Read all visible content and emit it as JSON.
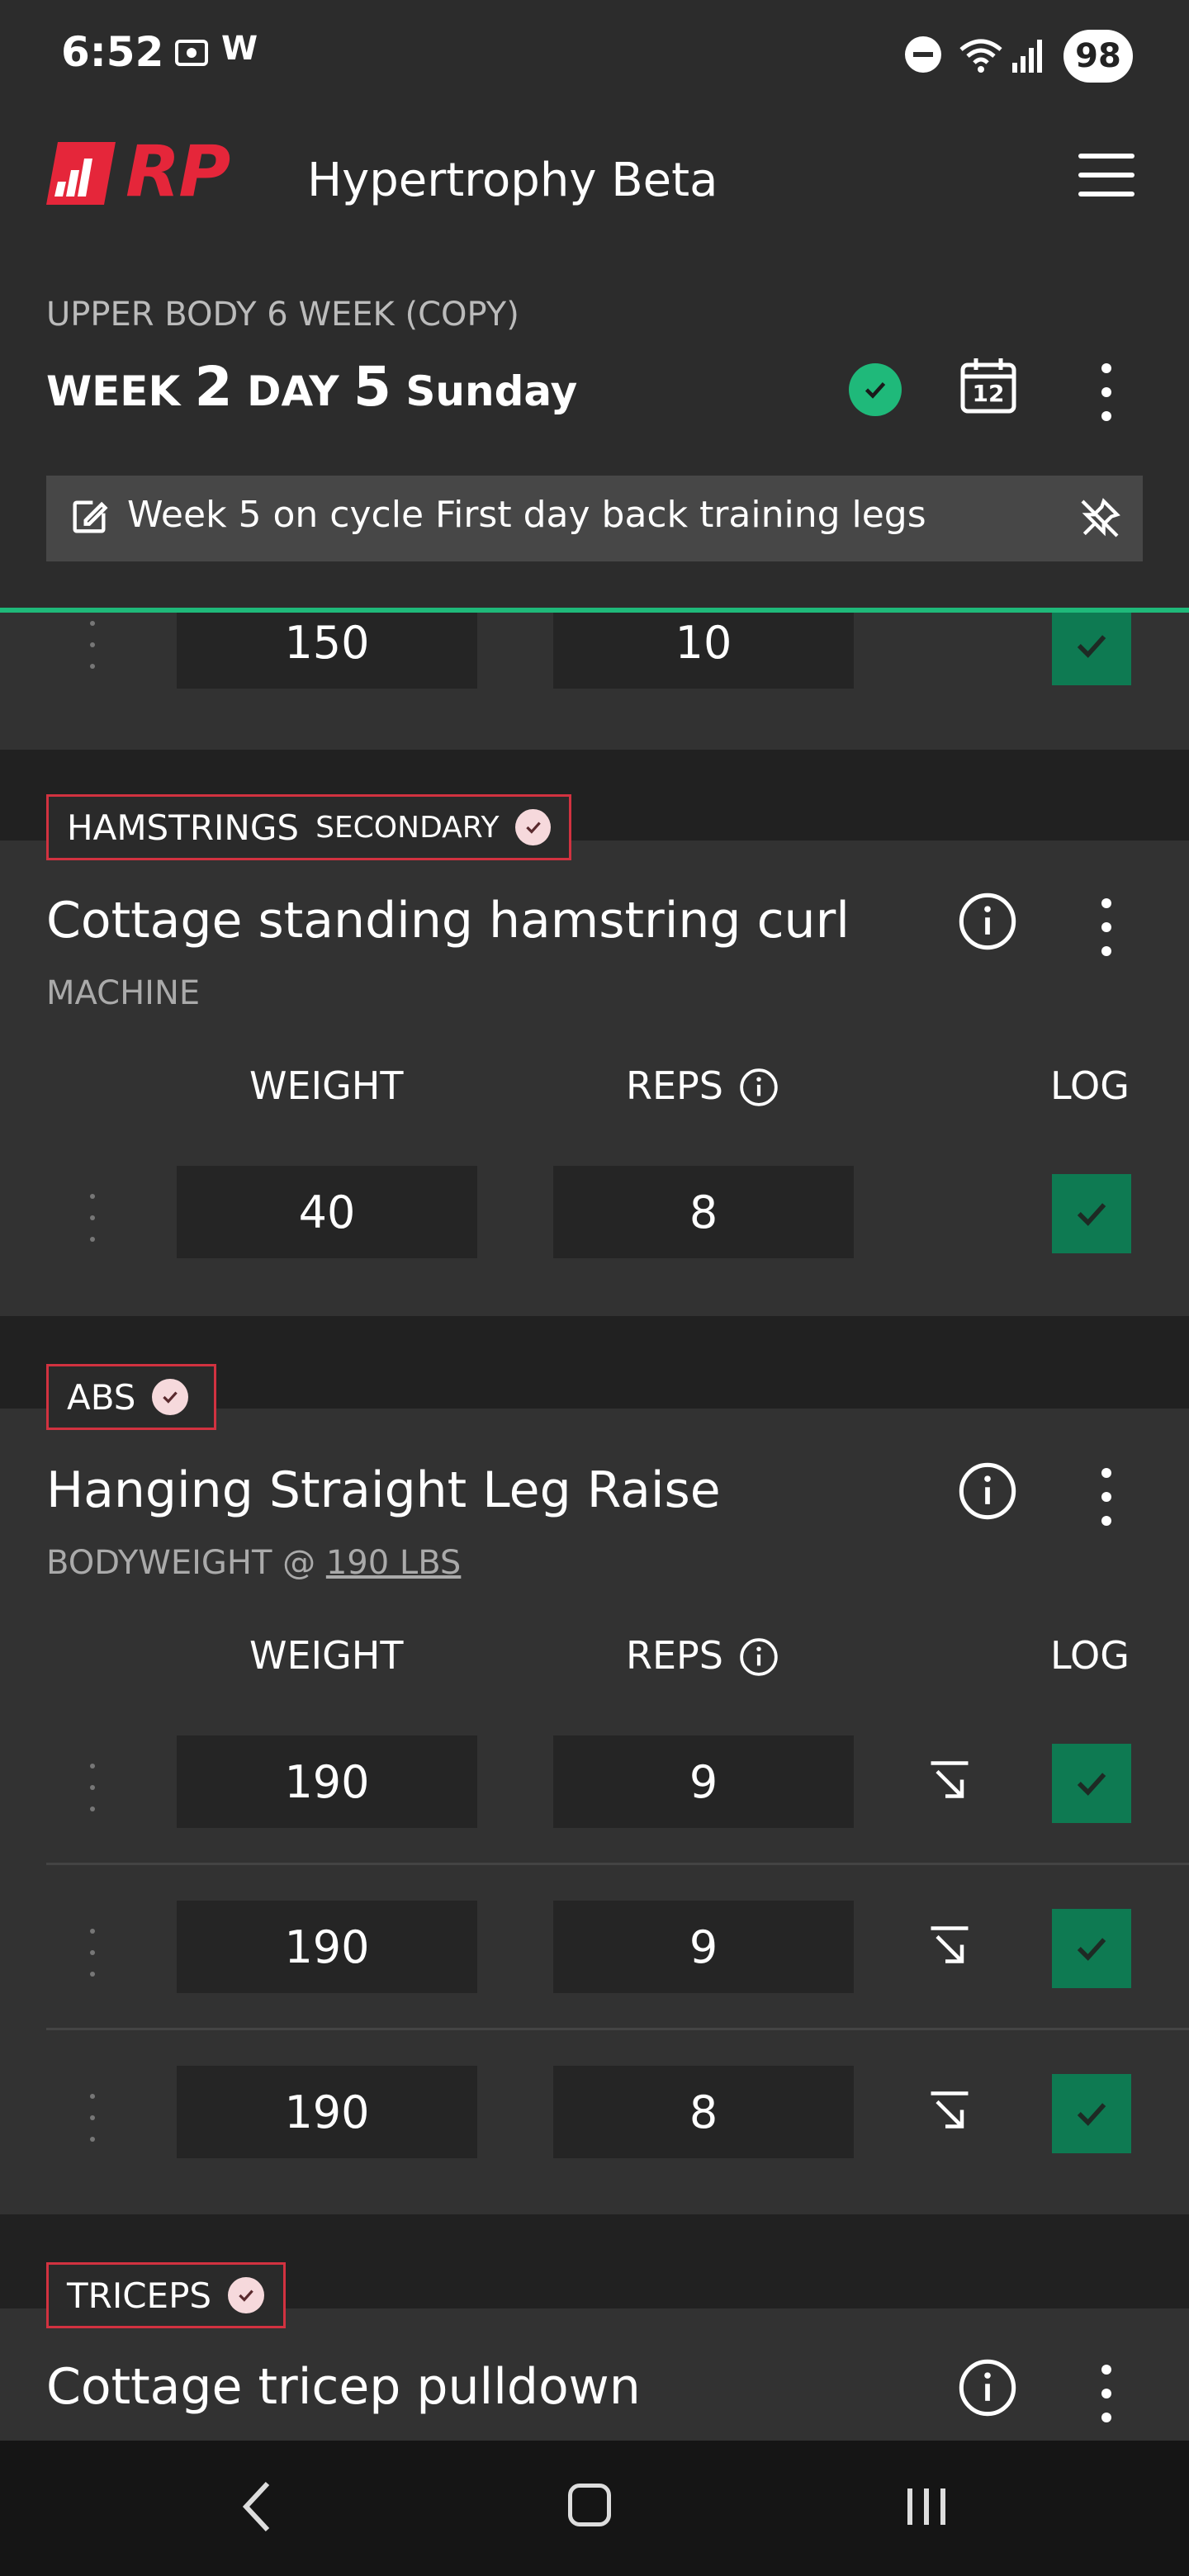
{
  "status": {
    "time": "6:52",
    "battery": "98"
  },
  "header": {
    "app_title": "Hypertrophy Beta",
    "logo": "RP",
    "program_name": "UPPER BODY 6 WEEK (COPY)",
    "week_label": "WEEK",
    "week_num": "2",
    "day_label": "DAY",
    "day_num": "5",
    "day_name": "Sunday",
    "calendar_day": "12",
    "note": "Week 5 on cycle First day back training legs"
  },
  "partial_row": {
    "weight": "150",
    "reps": "10"
  },
  "exercises": [
    {
      "muscle": "HAMSTRINGS",
      "tag_extra": "SECONDARY",
      "name": "Cottage standing hamstring curl",
      "type": "MACHINE",
      "col_weight": "WEIGHT",
      "col_reps": "REPS",
      "col_log": "LOG",
      "sets": [
        {
          "weight": "40",
          "reps": "8"
        }
      ]
    },
    {
      "muscle": "ABS",
      "name": "Hanging Straight Leg Raise",
      "type_prefix": "BODYWEIGHT @",
      "type_link": "190 LBS",
      "col_weight": "WEIGHT",
      "col_reps": "REPS",
      "col_log": "LOG",
      "sets": [
        {
          "weight": "190",
          "reps": "9"
        },
        {
          "weight": "190",
          "reps": "9"
        },
        {
          "weight": "190",
          "reps": "8"
        }
      ]
    },
    {
      "muscle": "TRICEPS",
      "name": "Cottage tricep pulldown"
    }
  ],
  "colors": {
    "accent_green": "#1fb97a",
    "log_green": "#0e7a52",
    "brand_red": "#e5263a"
  },
  "icons": [
    "menu-icon",
    "calendar-icon",
    "edit-icon",
    "unpin-icon",
    "info-icon",
    "more-vert-icon",
    "check-icon",
    "arrow-down-right-icon",
    "back-icon",
    "home-icon",
    "recents-icon"
  ]
}
